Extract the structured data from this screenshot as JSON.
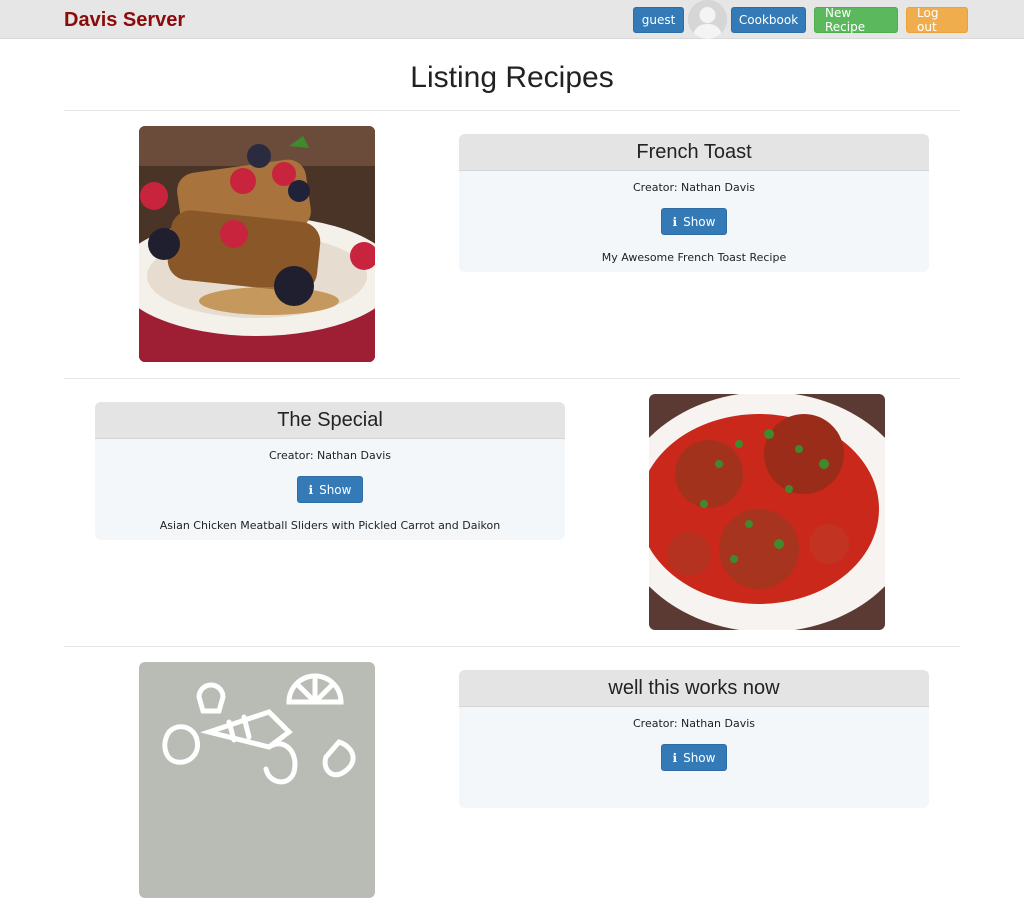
{
  "nav": {
    "brand": "Davis Server",
    "guest_label": "guest",
    "cookbook_label": "Cookbook",
    "new_recipe_label": "New Recipe",
    "logout_label": "Log out"
  },
  "page_title": "Listing Recipes",
  "recipes": [
    {
      "title": "French Toast",
      "creator": "Creator: Nathan Davis",
      "show_label": "Show",
      "description": "My Awesome French Toast Recipe",
      "image": "french-toast-photo"
    },
    {
      "title": "The Special",
      "creator": "Creator: Nathan Davis",
      "show_label": "Show",
      "description": "Asian Chicken Meatball Sliders with Pickled Carrot and Daikon",
      "image": "meatballs-photo"
    },
    {
      "title": "well this works now",
      "creator": "Creator: Nathan Davis",
      "show_label": "Show",
      "description": "",
      "image": "placeholder-food-icons"
    }
  ],
  "colors": {
    "brand": "#8b0a0a",
    "primary": "#337ab7",
    "success": "#5cb85c",
    "warning": "#f0ad4e"
  }
}
